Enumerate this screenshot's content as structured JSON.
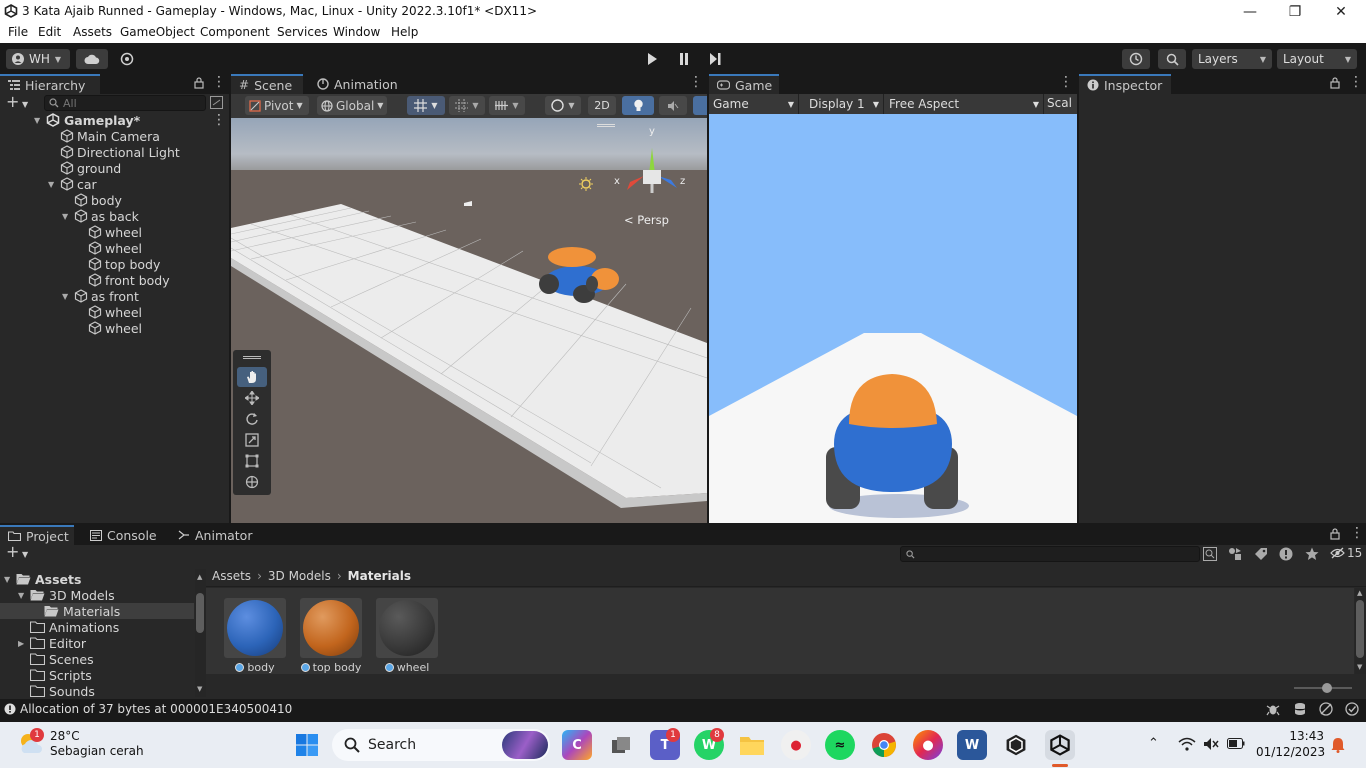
{
  "window": {
    "title": "3 Kata Ajaib Runned - Gameplay - Windows, Mac, Linux - Unity 2022.3.10f1* <DX11>"
  },
  "menu": [
    "File",
    "Edit",
    "Assets",
    "GameObject",
    "Component",
    "Services",
    "Window",
    "Help"
  ],
  "toolbar": {
    "account_label": "WH",
    "layers_label": "Layers",
    "layout_label": "Layout"
  },
  "hierarchy": {
    "tab_label": "Hierarchy",
    "search_placeholder": "All",
    "scene_name": "Gameplay*",
    "items": [
      {
        "label": "Main Camera",
        "depth": 1,
        "expand": ""
      },
      {
        "label": "Directional Light",
        "depth": 1,
        "expand": ""
      },
      {
        "label": "ground",
        "depth": 1,
        "expand": ""
      },
      {
        "label": "car",
        "depth": 1,
        "expand": "open"
      },
      {
        "label": "body",
        "depth": 2,
        "expand": ""
      },
      {
        "label": "as back",
        "depth": 2,
        "expand": "open"
      },
      {
        "label": "wheel",
        "depth": 3,
        "expand": ""
      },
      {
        "label": "wheel",
        "depth": 3,
        "expand": ""
      },
      {
        "label": "top body",
        "depth": 3,
        "expand": ""
      },
      {
        "label": "front body",
        "depth": 3,
        "expand": ""
      },
      {
        "label": "as front",
        "depth": 2,
        "expand": "open"
      },
      {
        "label": "wheel",
        "depth": 3,
        "expand": ""
      },
      {
        "label": "wheel",
        "depth": 3,
        "expand": ""
      }
    ]
  },
  "scene": {
    "tab_scene": "Scene",
    "tab_animation": "Animation",
    "pivot_label": "Pivot",
    "global_label": "Global",
    "mode_2d": "2D",
    "persp_label": "Persp",
    "gizmo_y": "y",
    "gizmo_x": "x",
    "gizmo_z": "z"
  },
  "game": {
    "tab_label": "Game",
    "game_dropdown": "Game",
    "display_dropdown": "Display 1",
    "aspect_dropdown": "Free Aspect",
    "scale_label": "Scal"
  },
  "inspector": {
    "tab_label": "Inspector"
  },
  "bottom": {
    "tab_project": "Project",
    "tab_console": "Console",
    "tab_animator": "Animator",
    "hidden_count": "15",
    "tree": [
      {
        "label": "Assets",
        "depth": 0,
        "expand": "open",
        "bold": true
      },
      {
        "label": "3D Models",
        "depth": 1,
        "expand": "open"
      },
      {
        "label": "Materials",
        "depth": 2,
        "expand": "",
        "selected": true
      },
      {
        "label": "Animations",
        "depth": 1,
        "expand": ""
      },
      {
        "label": "Editor",
        "depth": 1,
        "expand": "closed"
      },
      {
        "label": "Scenes",
        "depth": 1,
        "expand": ""
      },
      {
        "label": "Scripts",
        "depth": 1,
        "expand": ""
      },
      {
        "label": "Sounds",
        "depth": 1,
        "expand": ""
      }
    ],
    "breadcrumb": [
      "Assets",
      "3D Models",
      "Materials"
    ],
    "assets": [
      {
        "label": "body",
        "color": "#2c64b8"
      },
      {
        "label": "top body",
        "color": "#c2651d"
      },
      {
        "label": "wheel",
        "color": "#3a3a3a"
      }
    ]
  },
  "status": {
    "message": "Allocation of 37 bytes at 000001E340500410"
  },
  "taskbar": {
    "weather_temp": "28°C",
    "weather_desc": "Sebagian cerah",
    "search_label": "Search",
    "weather_badge": "1",
    "teams_badge": "1",
    "whatsapp_badge": "8",
    "time": "13:43",
    "date": "01/12/2023"
  },
  "colors": {
    "accent": "#3a79bb",
    "sky": "#87bdfb",
    "car_body": "#2f6fd0",
    "car_top": "#f0923a"
  }
}
